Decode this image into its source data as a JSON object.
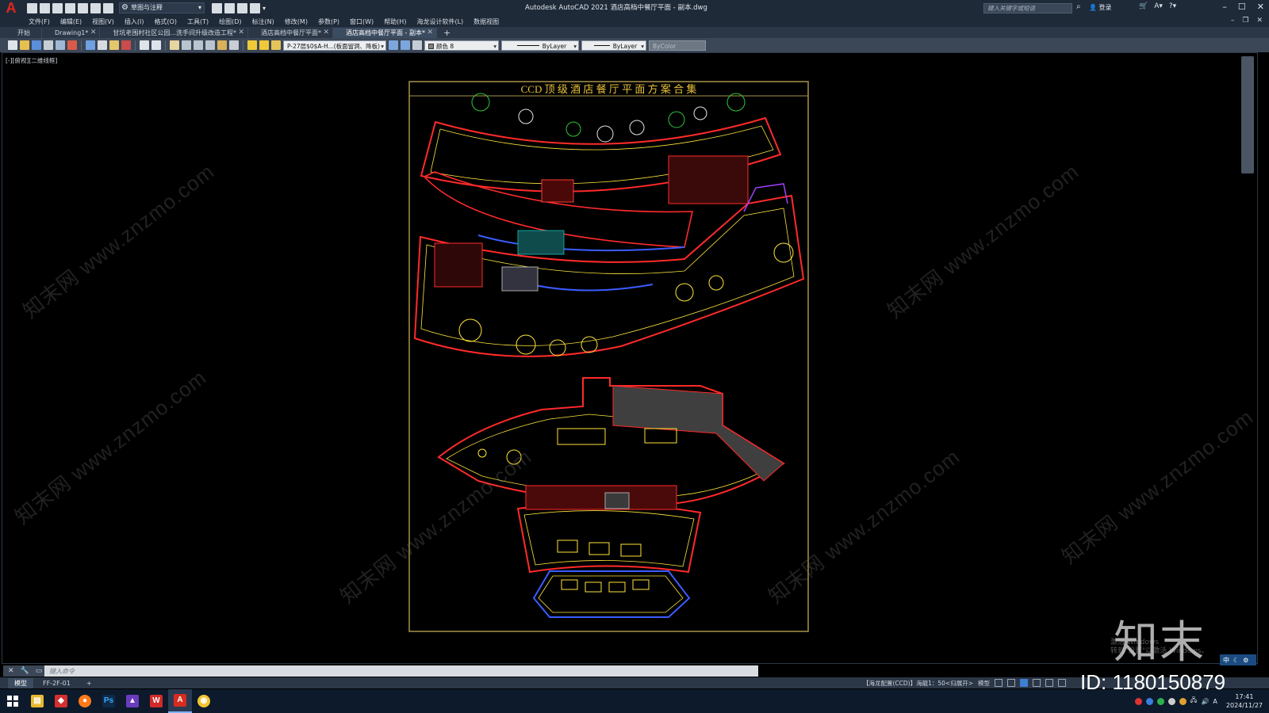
{
  "app": {
    "window_title": "Autodesk AutoCAD 2021    酒店高档中餐厅平面 - 副本.dwg",
    "workspace": "草图与注释",
    "search_placeholder": "键入关键字或短语",
    "login": "登录"
  },
  "menu": [
    "文件(F)",
    "编辑(E)",
    "视图(V)",
    "插入(I)",
    "格式(O)",
    "工具(T)",
    "绘图(D)",
    "标注(N)",
    "修改(M)",
    "参数(P)",
    "窗口(W)",
    "帮助(H)",
    "海龙设计软件(L)",
    "数据视图"
  ],
  "tabs": [
    {
      "label": "开始",
      "active": false,
      "closable": false
    },
    {
      "label": "Drawing1*",
      "active": false,
      "closable": true
    },
    {
      "label": "甘坑老围村社区公园...洗手间升级改造工程*",
      "active": false,
      "closable": true
    },
    {
      "label": "酒店高档中餐厅平面*",
      "active": false,
      "closable": true
    },
    {
      "label": "酒店高档中餐厅平面 - 副本*",
      "active": true,
      "closable": true
    }
  ],
  "toolbar": {
    "layer": "P-27层$0$A-H...(板面留洞、降板)",
    "color": "颜色 8",
    "linetype": "ByLayer",
    "lineweight": "ByLayer",
    "plotstyle": "ByColor"
  },
  "viewport": {
    "label": "[-][俯视][二维线框]",
    "drawing_title": "CCD 顶 级 酒 店 餐 厅 平 面 方 案 合 集"
  },
  "watermark": {
    "text": "知末网 www.znzmo.com",
    "brand": "知末",
    "id": "ID: 1180150879",
    "activation_line1": "激活 Windows",
    "activation_line2": "转到\"设置\"以激活 Windows。"
  },
  "commandline": {
    "placeholder": "键入命令"
  },
  "layout_tabs": [
    {
      "label": "模型",
      "active": true
    },
    {
      "label": "FF-2F-01",
      "active": false
    }
  ],
  "status": {
    "text": "【海龙配置(CCD)】海龍1：50<归展开>",
    "model": "模型"
  },
  "ime": {
    "lang": "中"
  },
  "clock": {
    "time": "17:41",
    "date": "2024/11/27"
  },
  "taskbar_apps": [
    "windows-start",
    "file-explorer",
    "app-red",
    "firefox",
    "photoshop",
    "app-purple",
    "wps",
    "autocad",
    "chrome"
  ]
}
